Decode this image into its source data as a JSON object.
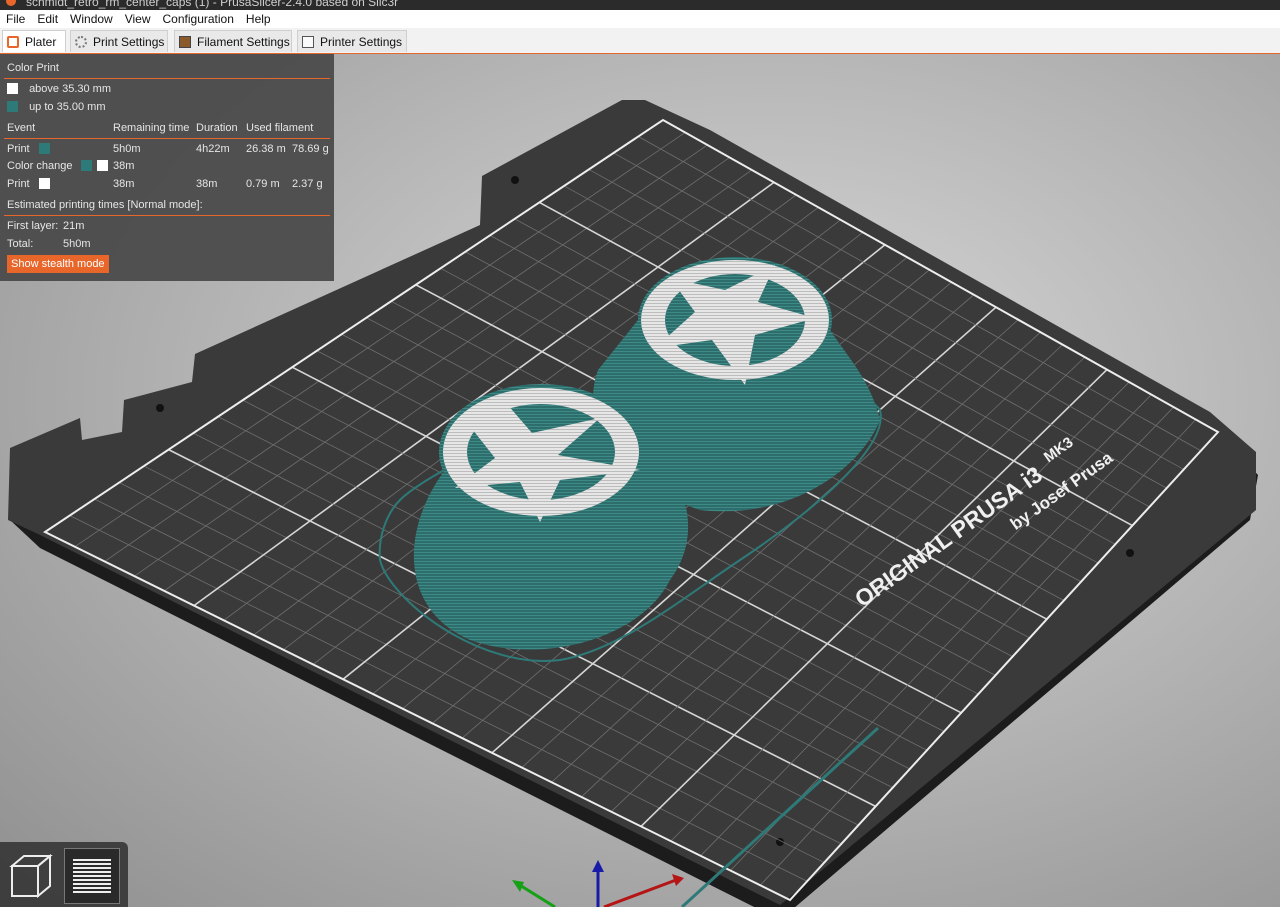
{
  "window": {
    "title": "schmidt_retro_rm_center_caps (1) - PrusaSlicer-2.4.0 based on Slic3r"
  },
  "menu": [
    "File",
    "Edit",
    "Window",
    "View",
    "Configuration",
    "Help"
  ],
  "tabs": [
    "Plater",
    "Print Settings",
    "Filament Settings",
    "Printer Settings"
  ],
  "panel": {
    "title": "Color Print",
    "legend": [
      {
        "label": "above 35.30 mm",
        "color": "#ffffff"
      },
      {
        "label": "up to 35.00 mm",
        "color": "#2e7a78"
      }
    ],
    "headers": [
      "Event",
      "Remaining time",
      "Duration",
      "Used filament"
    ],
    "rows": [
      {
        "event": "Print",
        "remaining": "5h0m",
        "duration": "4h22m",
        "length": "26.38 m",
        "weight": "78.69 g"
      },
      {
        "event": "Color change",
        "remaining": "38m",
        "duration": "",
        "length": "",
        "weight": ""
      },
      {
        "event": "Print",
        "remaining": "38m",
        "duration": "38m",
        "length": "0.79 m",
        "weight": "2.37 g"
      }
    ],
    "estimated_title": "Estimated printing times [Normal mode]:",
    "first_layer_label": "First layer:",
    "first_layer_value": "21m",
    "total_label": "Total:",
    "total_value": "5h0m",
    "stealth_button": "Show stealth mode"
  },
  "bed": {
    "brand": "ORIGINAL PRUSA i3",
    "model": "MK3",
    "maker": "by Josef Prusa"
  },
  "colors": {
    "accent": "#e8662a",
    "filament": "#2e7a78",
    "bed": "#3a3a3a",
    "grid": "#8a8a8a"
  },
  "view_buttons": [
    "3d-view-icon",
    "preview-layers-icon"
  ]
}
